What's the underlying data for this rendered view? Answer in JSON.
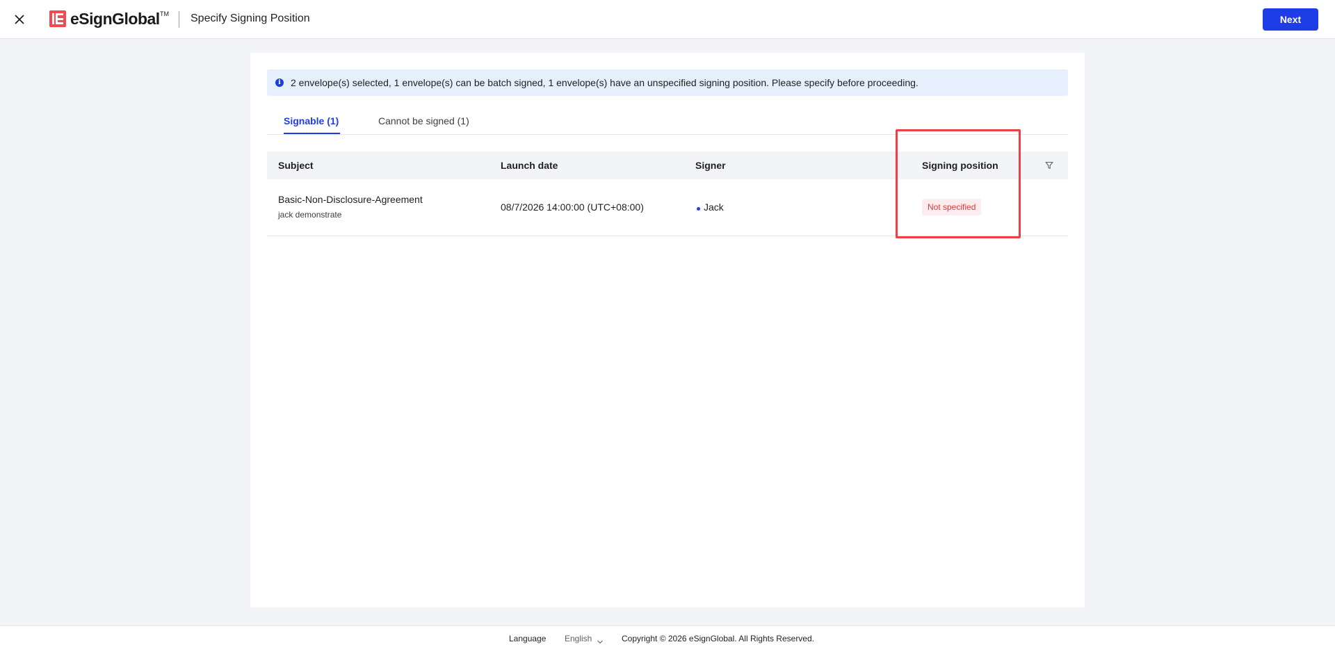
{
  "header": {
    "brand_name": "eSignGlobal",
    "brand_tm": "TM",
    "page_title": "Specify Signing Position",
    "next_label": "Next",
    "brand_color": "#f24a50",
    "accent_color": "#1f3de6"
  },
  "alert": {
    "icon": "info-icon",
    "message": "2 envelope(s) selected, 1 envelope(s) can be batch signed, 1 envelope(s) have an unspecified signing position. Please specify before proceeding."
  },
  "tabs": [
    {
      "label": "Signable (1)",
      "active": true
    },
    {
      "label": "Cannot be signed (1)",
      "active": false
    }
  ],
  "table": {
    "columns": [
      "Subject",
      "Launch date",
      "Signer",
      "Signing position"
    ],
    "filter_icon": "filter-icon",
    "rows": [
      {
        "subject": "Basic-Non-Disclosure-Agreement",
        "subject_sub": "jack demonstrate",
        "launch_date": "08/7/2026 14:00:00 (UTC+08:00)",
        "signer": "Jack",
        "signing_position": "Not specified"
      }
    ]
  },
  "footer": {
    "language_label": "Language",
    "language_value": "English",
    "copyright": "Copyright © 2026 eSignGlobal. All Rights Reserved."
  }
}
